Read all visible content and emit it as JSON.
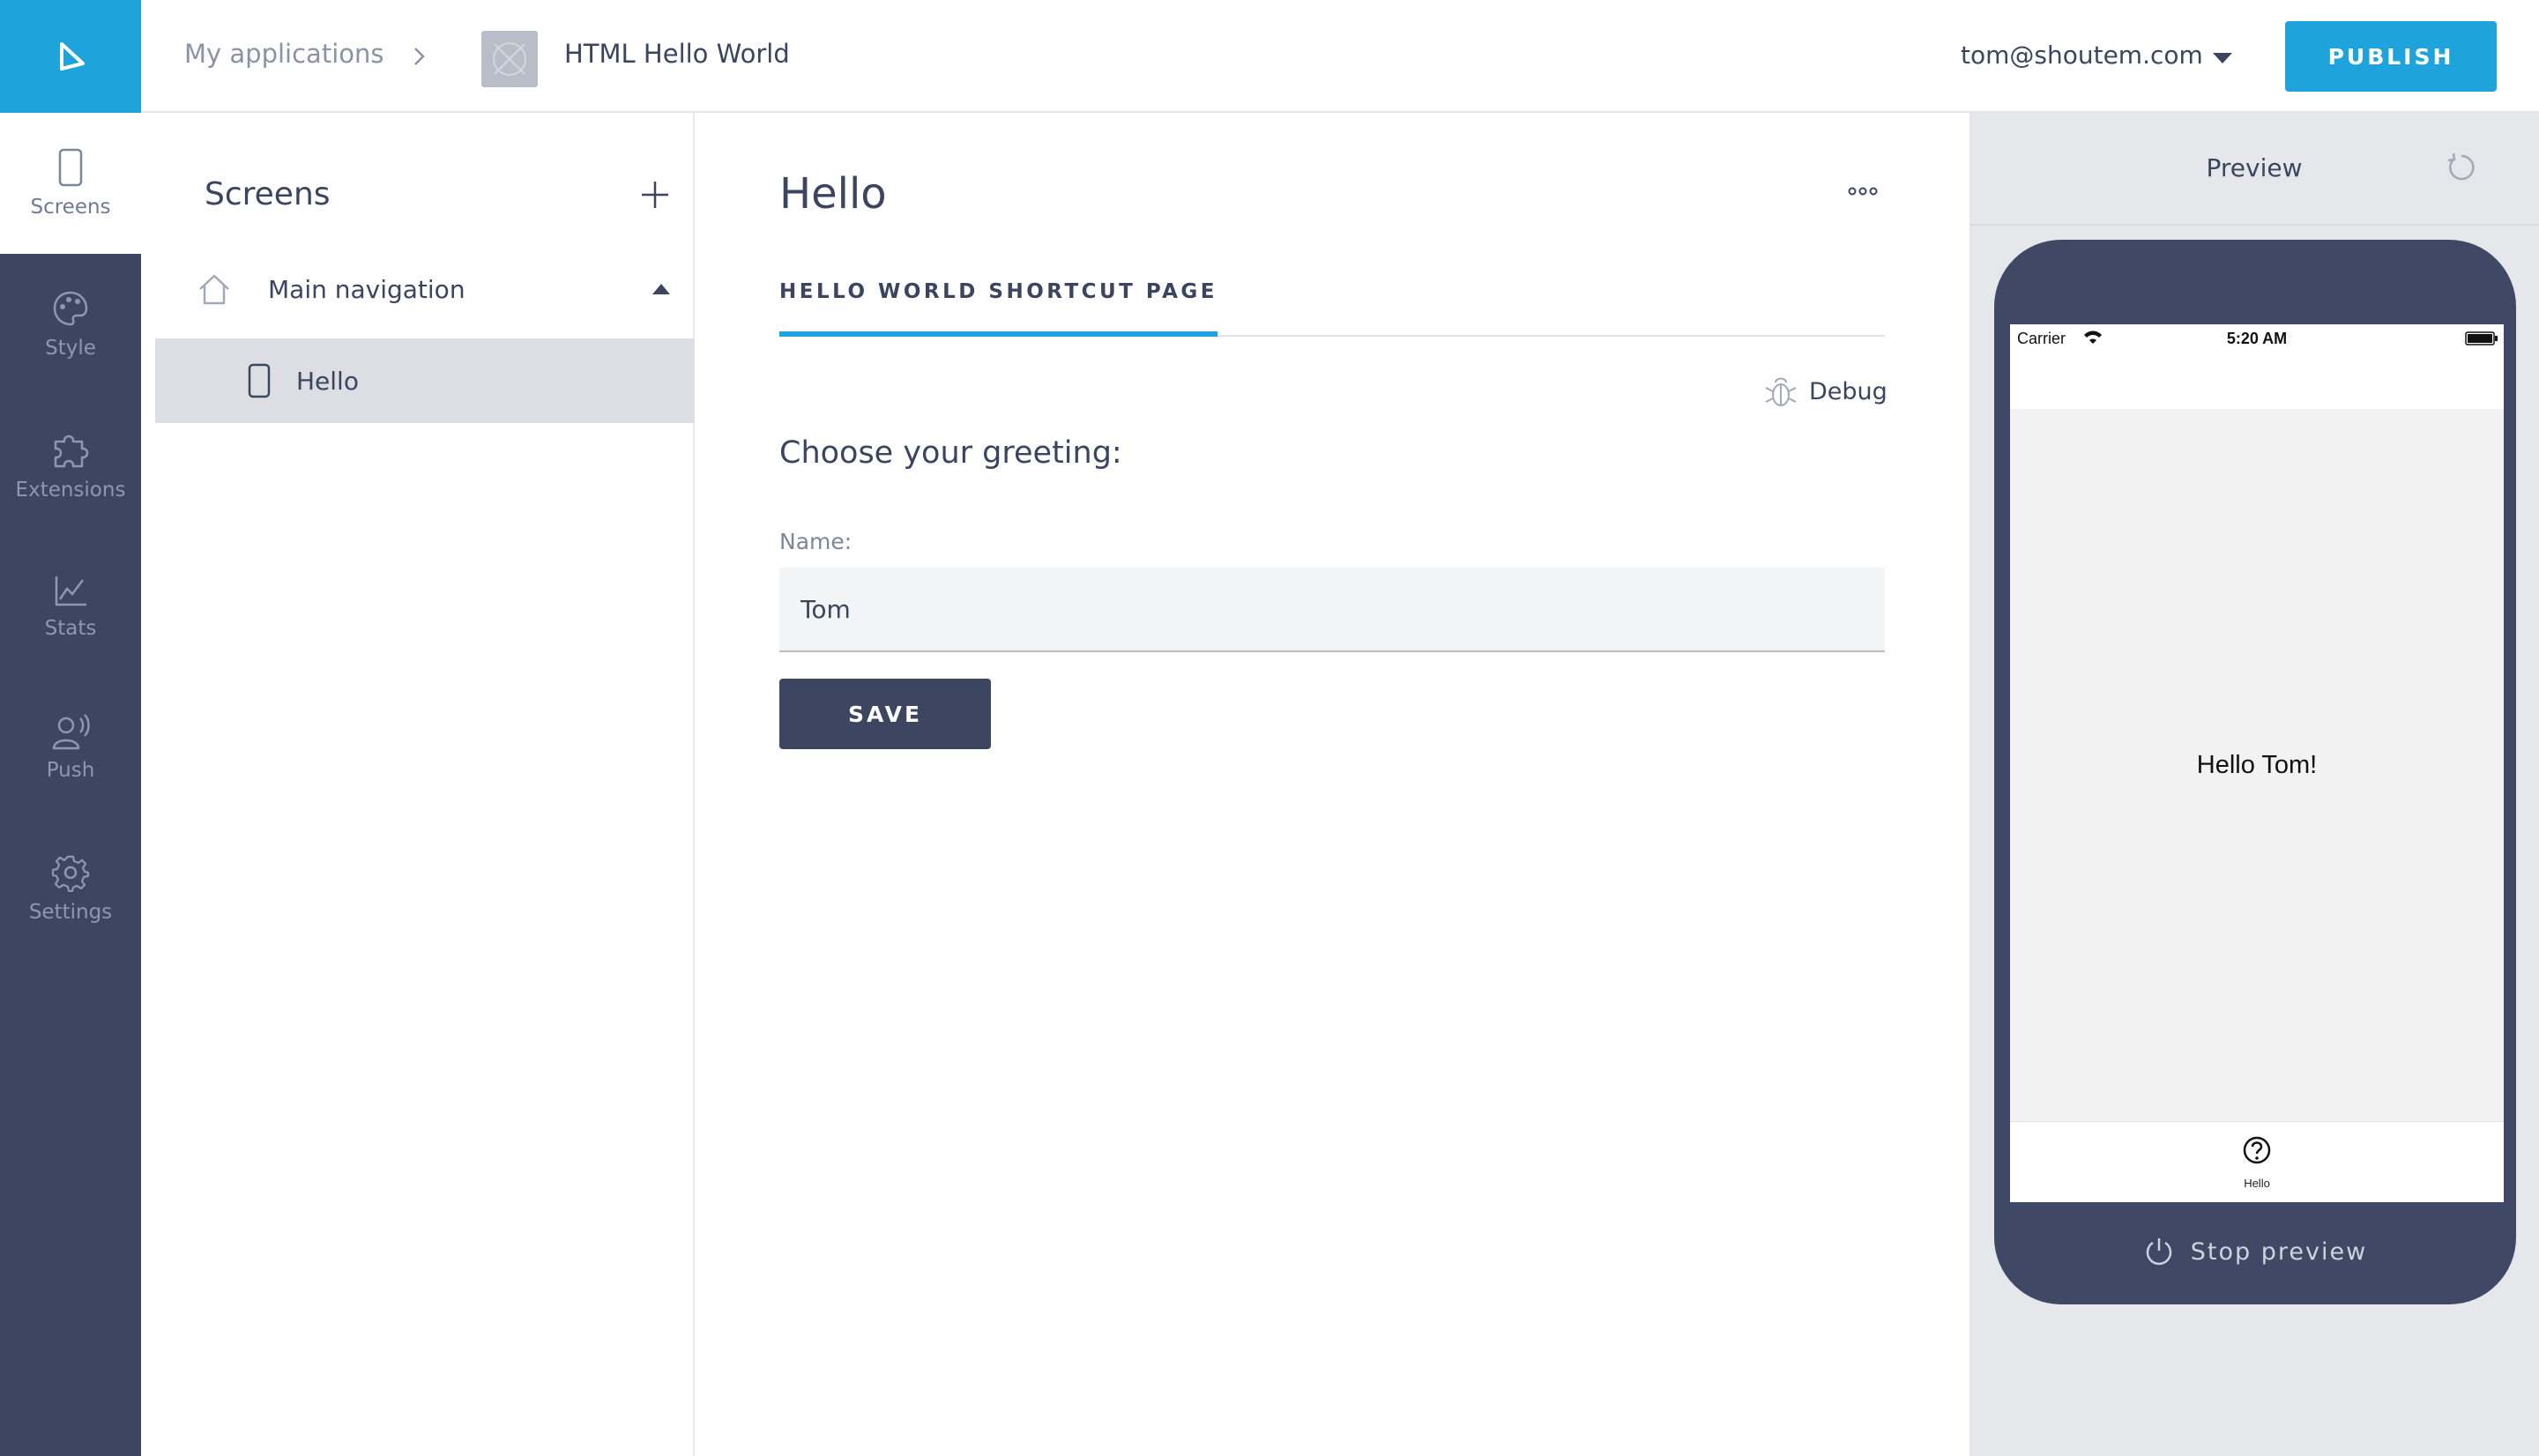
{
  "rail": {
    "items": [
      {
        "label": "Screens",
        "icon": "phone-icon",
        "active": true
      },
      {
        "label": "Style",
        "icon": "palette-icon"
      },
      {
        "label": "Extensions",
        "icon": "puzzle-icon"
      },
      {
        "label": "Stats",
        "icon": "chart-icon"
      },
      {
        "label": "Push",
        "icon": "push-icon"
      },
      {
        "label": "Settings",
        "icon": "gear-icon"
      }
    ]
  },
  "header": {
    "breadcrumb_root": "My applications",
    "app_title": "HTML Hello World",
    "user_email": "tom@shoutem.com",
    "publish_label": "PUBLISH"
  },
  "screens_panel": {
    "title": "Screens",
    "navigation_label": "Main navigation",
    "screen_label": "Hello"
  },
  "editor": {
    "title": "Hello",
    "tab_label": "HELLO WORLD SHORTCUT PAGE",
    "debug_label": "Debug",
    "greeting_heading": "Choose your greeting:",
    "name_label": "Name:",
    "name_value": "Tom",
    "save_label": "SAVE"
  },
  "preview": {
    "title": "Preview",
    "carrier": "Carrier",
    "time": "5:20 AM",
    "hello_text": "Hello Tom!",
    "tab_label": "Hello",
    "stop_label": "Stop preview"
  },
  "colors": {
    "accent": "#1ea3dc",
    "dark": "#3c4660",
    "device": "#3f4864"
  }
}
